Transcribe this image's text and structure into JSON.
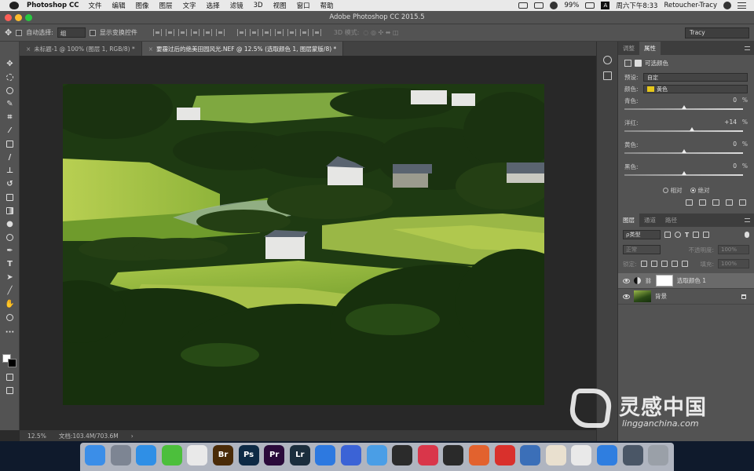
{
  "menubar": {
    "app_name": "Photoshop CC",
    "items": [
      "文件",
      "编辑",
      "图像",
      "图层",
      "文字",
      "选择",
      "滤镜",
      "3D",
      "视图",
      "窗口",
      "帮助"
    ],
    "battery": "99%",
    "input_method": "A",
    "datetime": "周六下午8:33",
    "user": "Retoucher-Tracy"
  },
  "window": {
    "title": "Adobe Photoshop CC 2015.5"
  },
  "options_bar": {
    "auto_select_label": "自动选择:",
    "auto_select_value": "组",
    "show_transform_label": "显示变换控件",
    "mode_3d_label": "3D 模式:",
    "workspace": "Tracy"
  },
  "tabs": [
    {
      "label": "未标题-1 @ 100% (图层 1, RGB/8) *",
      "active": false
    },
    {
      "label": "要霾过后的绝美田园风光.NEF @ 12.5% (选取颜色 1, 图层蒙版/8) *",
      "active": true
    }
  ],
  "status": {
    "zoom": "12.5%",
    "doc": "文档:103.4M/703.6M"
  },
  "properties": {
    "tabs": [
      "调整",
      "属性"
    ],
    "active_tab": "属性",
    "title": "可选颜色",
    "preset_label": "预设:",
    "preset_value": "自定",
    "colors_label": "颜色:",
    "colors_value": "黄色",
    "colors_swatch": "#e6c71a",
    "sliders": [
      {
        "label": "青色:",
        "value": "0",
        "unit": "%",
        "amount": 0
      },
      {
        "label": "洋红:",
        "value": "+14",
        "unit": "%",
        "amount": 14
      },
      {
        "label": "黄色:",
        "value": "0",
        "unit": "%",
        "amount": 0
      },
      {
        "label": "黑色:",
        "value": "0",
        "unit": "%",
        "amount": 0
      }
    ],
    "method_relative": "相对",
    "method_absolute": "绝对",
    "method_selected": "absolute"
  },
  "layers_panel": {
    "tabs": [
      "图层",
      "通道",
      "路径"
    ],
    "active_tab": "图层",
    "filter_kind": "ρ类型",
    "blend_mode": "正常",
    "opacity_label": "不透明度:",
    "opacity_value": "100%",
    "lock_label": "锁定:",
    "fill_label": "填充:",
    "fill_value": "100%",
    "layers": [
      {
        "name": "选取颜色 1",
        "type": "adjustment",
        "selected": true
      },
      {
        "name": "背景",
        "type": "background",
        "selected": false,
        "locked": true
      }
    ]
  },
  "watermark": {
    "text": "灵感中国",
    "url": "lingganchina.com"
  },
  "dock": {
    "apps": [
      {
        "name": "finder-icon",
        "color": "#3b8ee8",
        "text": ""
      },
      {
        "name": "launchpad-icon",
        "color": "#7d8593",
        "text": ""
      },
      {
        "name": "safari-icon",
        "color": "#2f8fe6",
        "text": ""
      },
      {
        "name": "wechat-icon",
        "color": "#4cbf3c",
        "text": ""
      },
      {
        "name": "qq-icon",
        "color": "#e9e9e9",
        "text": ""
      },
      {
        "name": "bridge-icon",
        "color": "#4a2b08",
        "text": "Br"
      },
      {
        "name": "photoshop-icon",
        "color": "#0d2a45",
        "text": "Ps"
      },
      {
        "name": "premiere-icon",
        "color": "#2a0a3a",
        "text": "Pr"
      },
      {
        "name": "lightroom-icon",
        "color": "#1b2e3d",
        "text": "Lr"
      },
      {
        "name": "baidu-cloud-icon",
        "color": "#2d79e0",
        "text": ""
      },
      {
        "name": "video-app-icon",
        "color": "#3b63d6",
        "text": ""
      },
      {
        "name": "one-app-icon",
        "color": "#4a9ee6",
        "text": ""
      },
      {
        "name": "davinci-icon",
        "color": "#2b2b2b",
        "text": ""
      },
      {
        "name": "music-app-icon",
        "color": "#d9364a",
        "text": ""
      },
      {
        "name": "obs-icon",
        "color": "#2a2a2a",
        "text": ""
      },
      {
        "name": "red-app-icon",
        "color": "#e2622e",
        "text": ""
      },
      {
        "name": "netease-icon",
        "color": "#d9302c",
        "text": ""
      },
      {
        "name": "browser-icon",
        "color": "#3b6fb8",
        "text": ""
      },
      {
        "name": "notes-icon",
        "color": "#e9e0cf",
        "text": ""
      },
      {
        "name": "charts-app-icon",
        "color": "#e9e9e9",
        "text": ""
      },
      {
        "name": "keynote-icon",
        "color": "#2f7ee0",
        "text": ""
      },
      {
        "name": "screenshot-icon",
        "color": "#4a5666",
        "text": ""
      },
      {
        "name": "trash-icon",
        "color": "#9aa0a8",
        "text": ""
      }
    ]
  }
}
